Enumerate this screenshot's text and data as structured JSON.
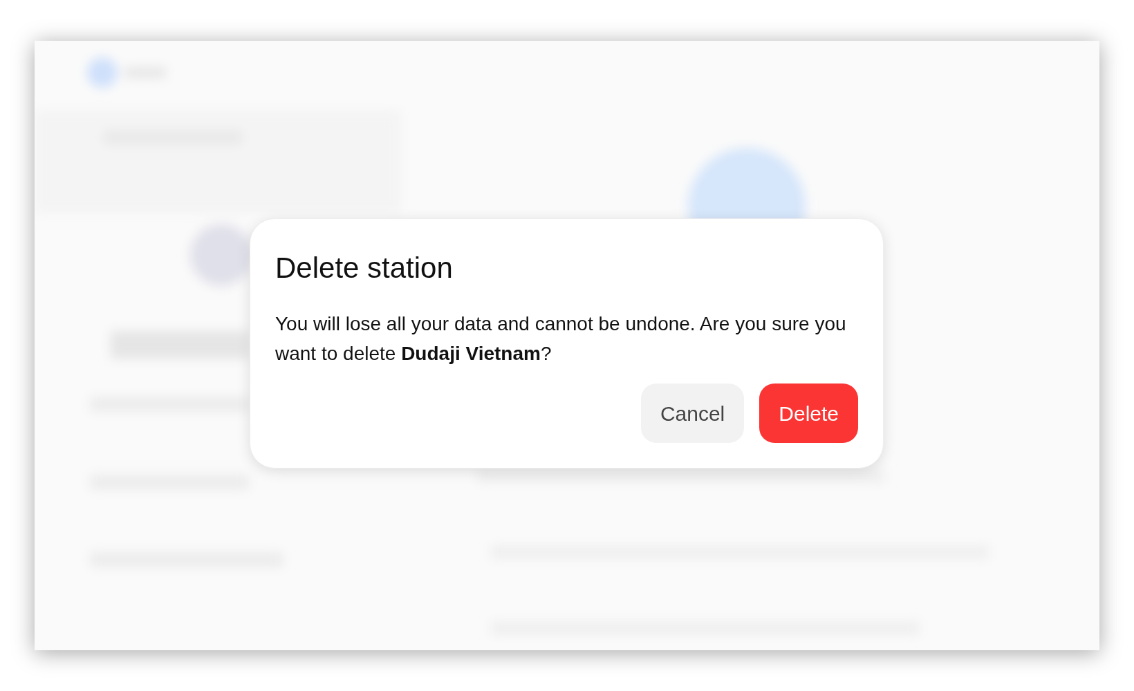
{
  "dialog": {
    "title": "Delete station",
    "message": "You will lose all your data and cannot be undone. Are you sure you want to delete **Dudaji Vietnam**?",
    "buttons": [
      {
        "label": "Cancel",
        "kind": "secondary"
      },
      {
        "label": "Delete",
        "kind": "danger"
      }
    ]
  }
}
